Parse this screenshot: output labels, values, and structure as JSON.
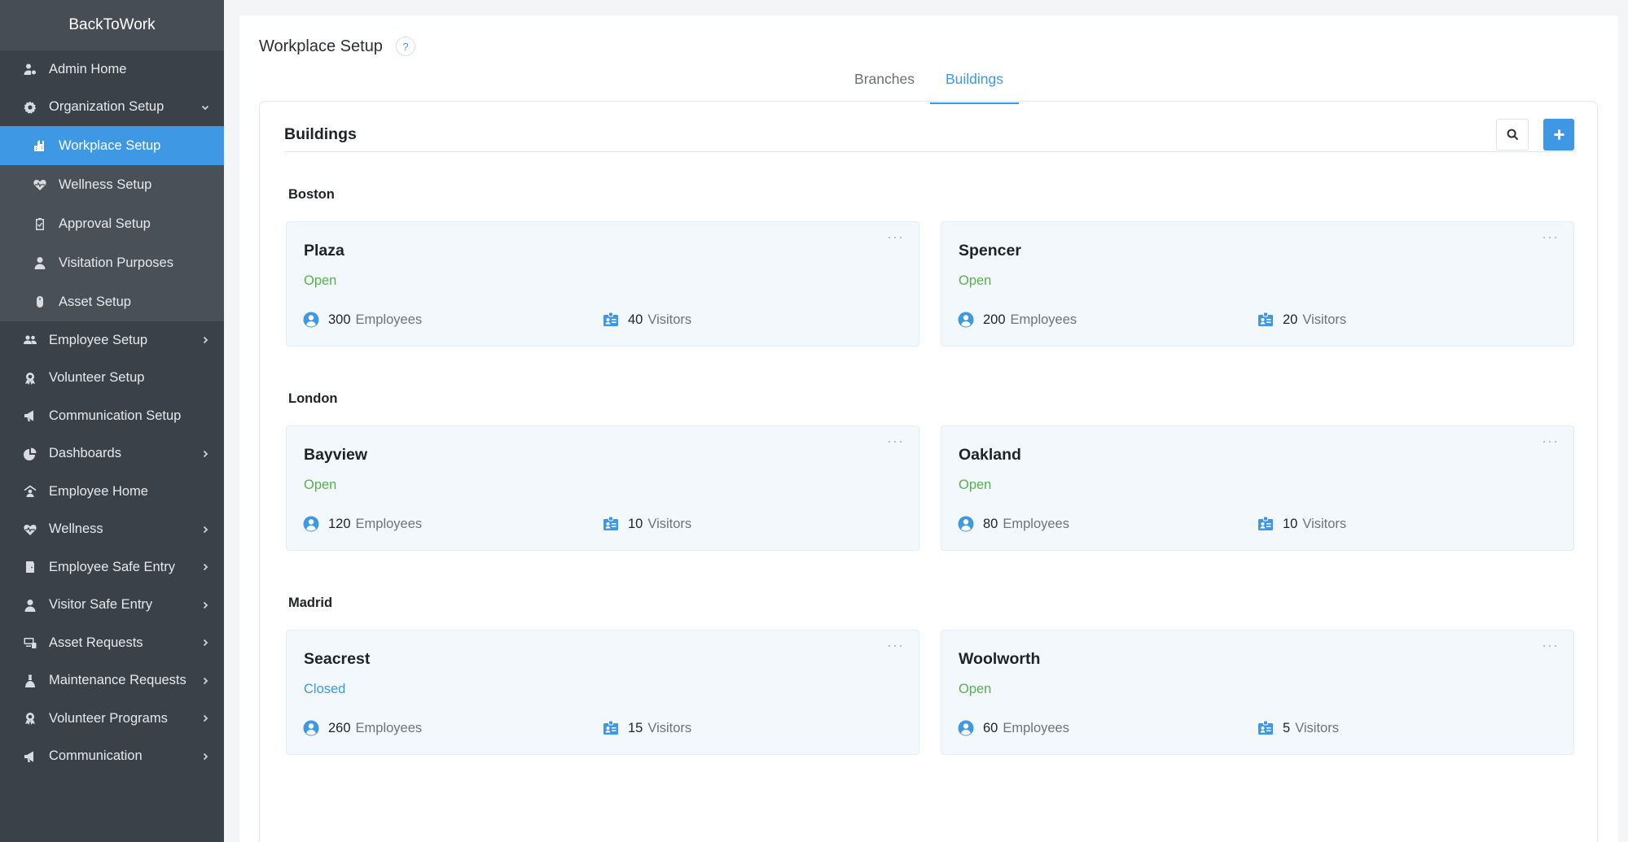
{
  "app": {
    "brand": "BackToWork"
  },
  "sidebar": {
    "items": [
      {
        "label": "Admin Home",
        "icon": "user-gear-icon"
      },
      {
        "label": "Organization Setup",
        "icon": "gear-icon"
      },
      {
        "label": "Workplace Setup",
        "icon": "building-icon"
      },
      {
        "label": "Wellness Setup",
        "icon": "heart-pulse-icon"
      },
      {
        "label": "Approval Setup",
        "icon": "clipboard-check-icon"
      },
      {
        "label": "Visitation Purposes",
        "icon": "person-icon"
      },
      {
        "label": "Asset Setup",
        "icon": "mouse-icon"
      },
      {
        "label": "Employee Setup",
        "icon": "users-icon"
      },
      {
        "label": "Volunteer Setup",
        "icon": "award-icon"
      },
      {
        "label": "Communication Setup",
        "icon": "megaphone-icon"
      },
      {
        "label": "Dashboards",
        "icon": "pie-chart-icon"
      },
      {
        "label": "Employee Home",
        "icon": "home-user-icon"
      },
      {
        "label": "Wellness",
        "icon": "heart-pulse-icon"
      },
      {
        "label": "Employee Safe Entry",
        "icon": "door-icon"
      },
      {
        "label": "Visitor Safe Entry",
        "icon": "person-icon"
      },
      {
        "label": "Asset Requests",
        "icon": "asset-icon"
      },
      {
        "label": "Maintenance Requests",
        "icon": "wrench-person-icon"
      },
      {
        "label": "Volunteer Programs",
        "icon": "award-icon"
      },
      {
        "label": "Communication",
        "icon": "megaphone-icon"
      }
    ]
  },
  "main": {
    "title": "Workplace Setup",
    "help": "?",
    "tabs": [
      {
        "label": "Branches",
        "active": false
      },
      {
        "label": "Buildings",
        "active": true
      }
    ],
    "panel": {
      "title": "Buildings",
      "groups": [
        {
          "city": "Boston",
          "buildings": [
            {
              "name": "Plaza",
              "status": "Open",
              "employees": "300",
              "visitors": "40"
            },
            {
              "name": "Spencer",
              "status": "Open",
              "employees": "200",
              "visitors": "20"
            }
          ]
        },
        {
          "city": "London",
          "buildings": [
            {
              "name": "Bayview",
              "status": "Open",
              "employees": "120",
              "visitors": "10"
            },
            {
              "name": "Oakland",
              "status": "Open",
              "employees": "80",
              "visitors": "10"
            }
          ]
        },
        {
          "city": "Madrid",
          "buildings": [
            {
              "name": "Seacrest",
              "status": "Closed",
              "employees": "260",
              "visitors": "15"
            },
            {
              "name": "Woolworth",
              "status": "Open",
              "employees": "60",
              "visitors": "5"
            }
          ]
        }
      ],
      "labels": {
        "employees": "Employees",
        "visitors": "Visitors",
        "more": "···"
      }
    }
  },
  "colors": {
    "accent": "#3e98e3",
    "open": "#58b04e",
    "sidebar": "#3b4149"
  }
}
